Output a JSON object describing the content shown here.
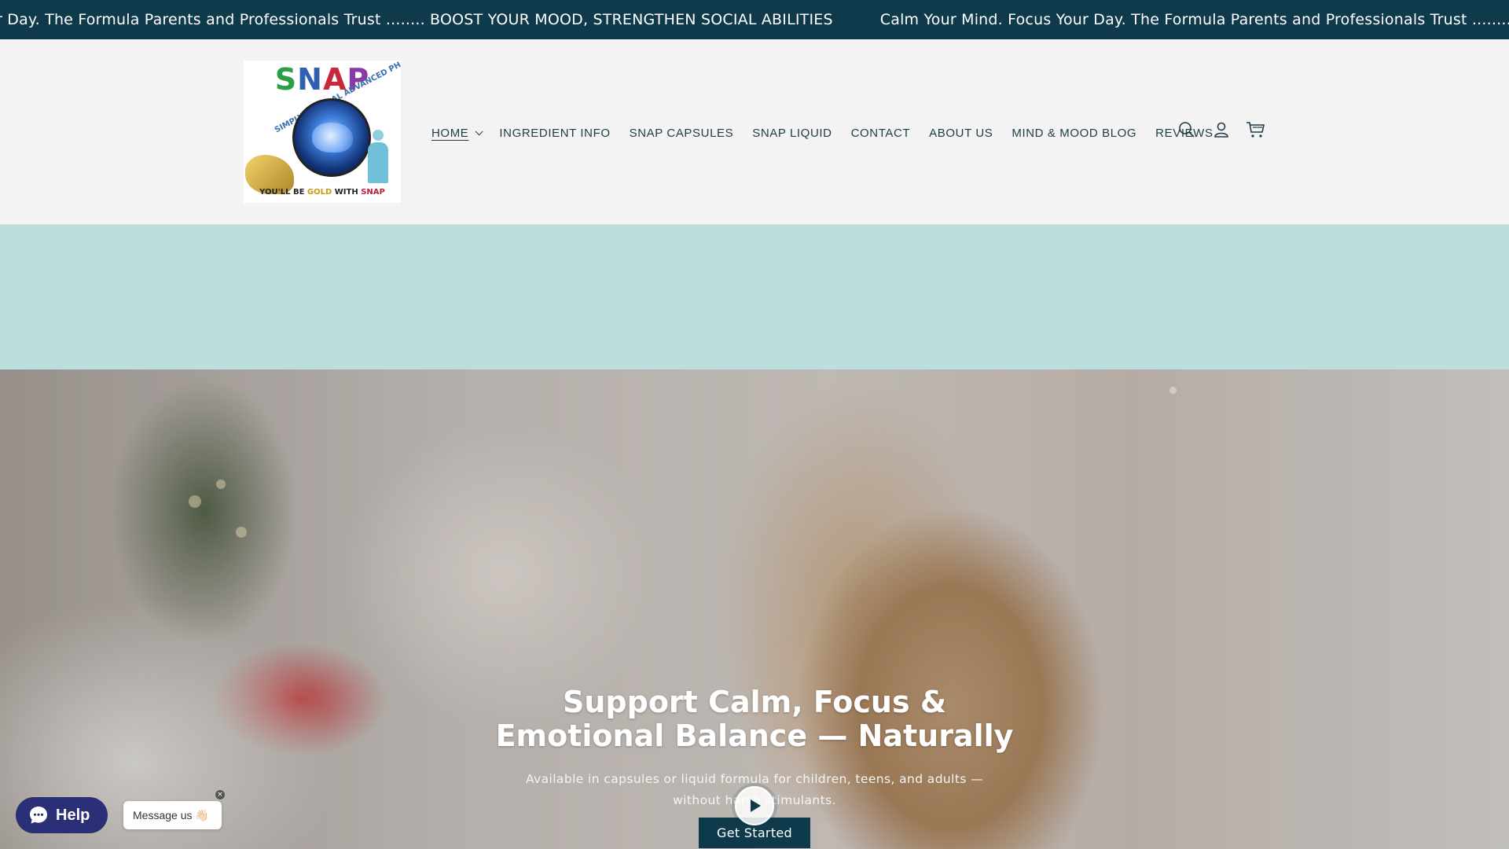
{
  "announcement": {
    "items": [
      "Calm Your Mind. Focus Your Day. The Formula Parents and Professionals Trust ........ BOOST YOUR MOOD, STRENGTHEN SOCIAL ABILITIES",
      "Calm Your Mind. Focus Your Day. The Formula Parents and Professionals Trust ........ BOOST YOUR MOOD, STRENGTHEN SOCIAL ABILITIES"
    ],
    "visible_prefix": "r Day. The Formula Parents and Professionals Trust ........ BOOST YOUR MOOD, STRENGTHEN SOCIAL ABILITIES",
    "visible_second": "Calm Your Mind. Focus Your Day. The Formula Parents and Professionals Trust ........ BOOST YOUR M",
    "background": "#0e3a4b"
  },
  "logo": {
    "word": "SNAP",
    "arc_text": "SIMPLY NATURAL ADVANCED PHARMA",
    "tagline_a": "YOU'LL BE ",
    "tagline_gold": "GOLD",
    "tagline_b": " WITH ",
    "tagline_snap": "SNAP"
  },
  "nav": {
    "items": [
      {
        "label": "HOME",
        "active": true,
        "has_dropdown": true
      },
      {
        "label": "INGREDIENT INFO"
      },
      {
        "label": "SNAP CAPSULES"
      },
      {
        "label": "SNAP LIQUID"
      },
      {
        "label": "CONTACT"
      },
      {
        "label": "ABOUT US"
      },
      {
        "label": "MIND & MOOD BLOG"
      },
      {
        "label": "REVIEWS"
      }
    ],
    "icons": [
      "search-icon",
      "account-icon",
      "cart-icon"
    ]
  },
  "colors": {
    "brand_dark": "#0e3a4b",
    "band": "#bcdfdd",
    "help_purple": "#2b2f76"
  },
  "hero": {
    "title": "Support Calm, Focus &\nEmotional Balance — Naturally",
    "subtitle": "Available in capsules or liquid formula for children, teens, and adults —\nwithout harsh stimulants.",
    "cta": "Get Started"
  },
  "chat": {
    "help_label": "Help",
    "message_label": "Message us 👋🏻",
    "close_glyph": "×"
  }
}
